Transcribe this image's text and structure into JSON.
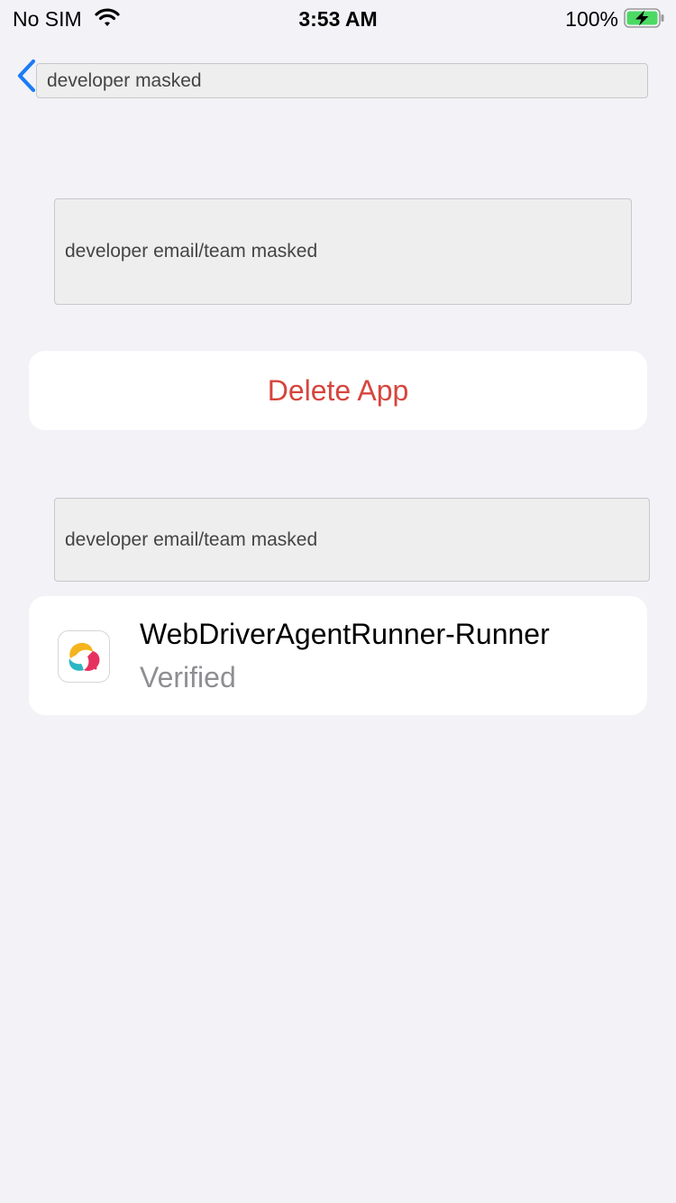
{
  "status_bar": {
    "carrier": "No SIM",
    "time": "3:53 AM",
    "battery_percent": "100%",
    "battery_charging": true,
    "battery_color": "#4cd964"
  },
  "nav": {
    "back_icon": "chevron-left-icon",
    "title_field": "developer masked"
  },
  "developer_section": {
    "masked_text": "developer email/team masked"
  },
  "delete_button": {
    "label": "Delete App",
    "color": "#d6453d"
  },
  "apps_section": {
    "masked_text": "developer email/team masked",
    "apps": [
      {
        "name": "WebDriverAgentRunner-Runner",
        "status": "Verified"
      }
    ]
  }
}
